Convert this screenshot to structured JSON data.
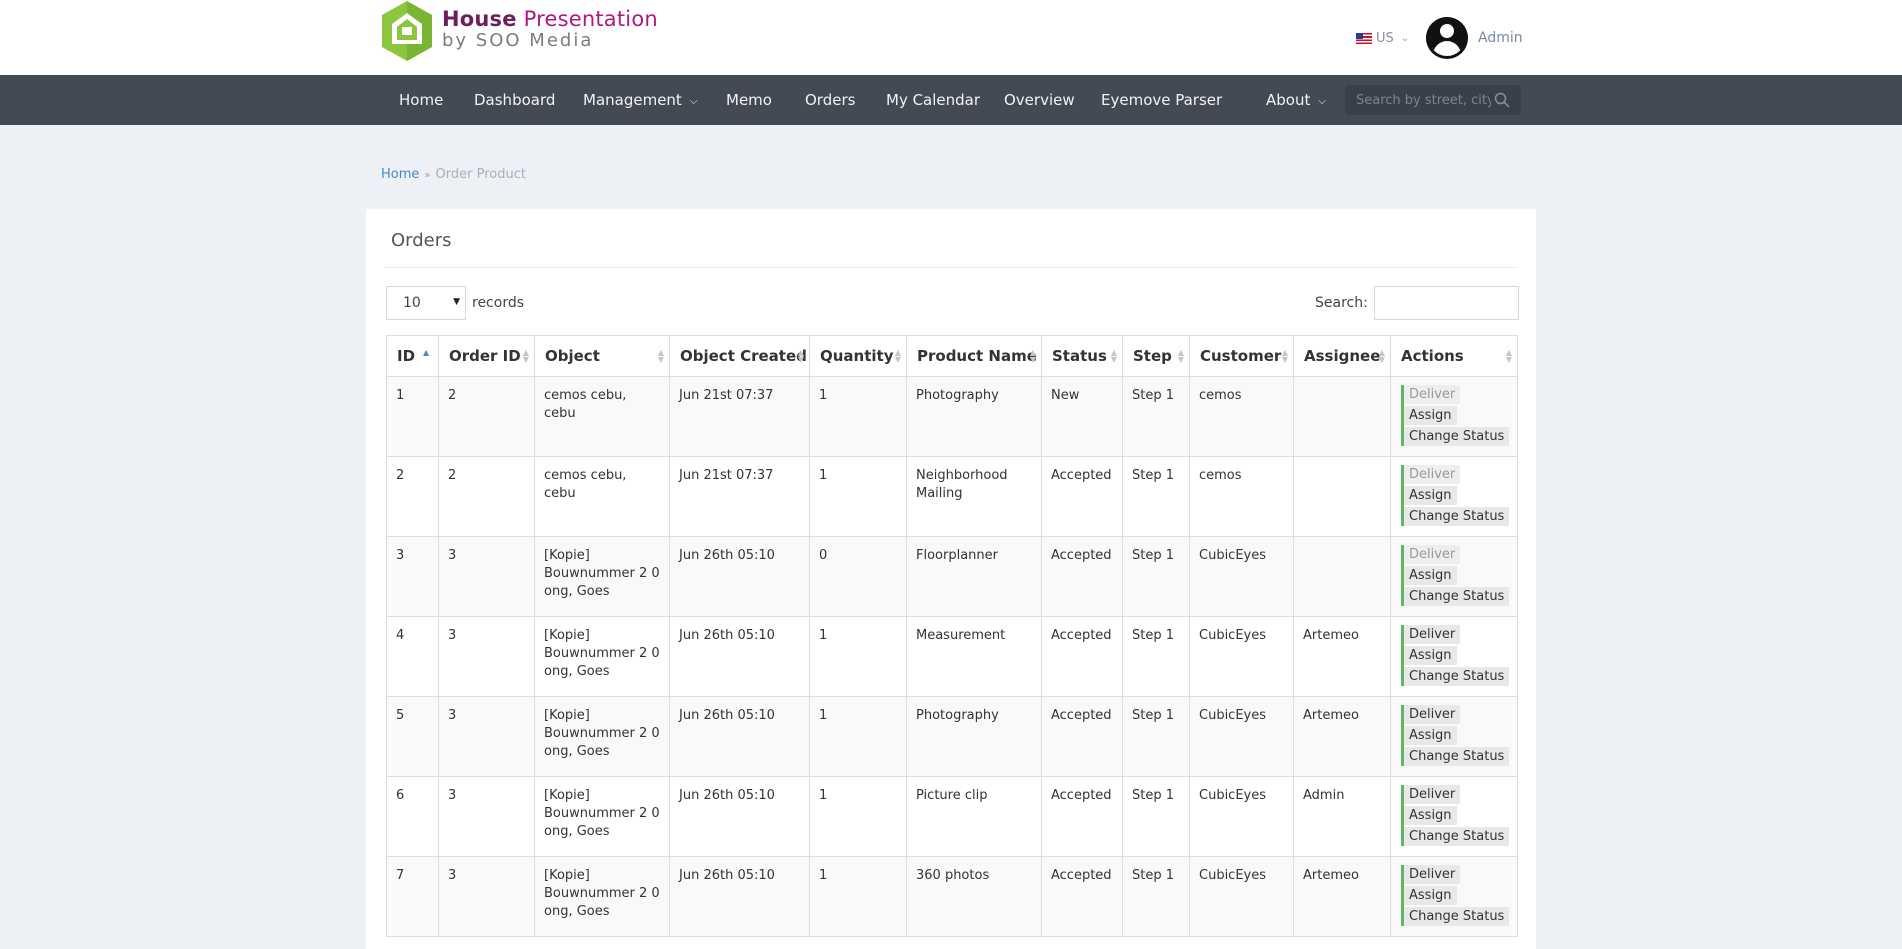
{
  "logo": {
    "house": "House",
    "presentation": "Presentation",
    "tagline": "by SOO Media"
  },
  "header": {
    "language": "US",
    "user": "Admin"
  },
  "nav": {
    "items": [
      {
        "label": "Home"
      },
      {
        "label": "Dashboard"
      },
      {
        "label": "Management",
        "dropdown": true
      },
      {
        "label": "Memo"
      },
      {
        "label": "Orders"
      },
      {
        "label": "My Calendar"
      },
      {
        "label": "Overview"
      },
      {
        "label": "Eyemove Parser"
      },
      {
        "label": "About",
        "dropdown": true
      }
    ],
    "search_placeholder": "Search by street, city or zip"
  },
  "breadcrumb": {
    "home": "Home",
    "current": "Order Product"
  },
  "panel": {
    "title": "Orders",
    "records_value": "10",
    "records_label": "records",
    "search_label": "Search:"
  },
  "table": {
    "columns": [
      "ID",
      "Order ID",
      "Object",
      "Object Created",
      "Quantity",
      "Product Name",
      "Status",
      "Step",
      "Customer",
      "Assignee",
      "Actions"
    ],
    "actions": [
      "Deliver",
      "Assign",
      "Change Status"
    ],
    "rows": [
      {
        "id": "1",
        "order_id": "2",
        "object": "cemos cebu, cebu",
        "created": "Jun 21st 07:37",
        "quantity": "1",
        "product": "Photography",
        "status": "New",
        "step": "Step 1",
        "customer": "cemos",
        "assignee": "",
        "deliver_enabled": false
      },
      {
        "id": "2",
        "order_id": "2",
        "object": "cemos cebu, cebu",
        "created": "Jun 21st 07:37",
        "quantity": "1",
        "product": "Neighborhood Mailing",
        "status": "Accepted",
        "step": "Step 1",
        "customer": "cemos",
        "assignee": "",
        "deliver_enabled": false
      },
      {
        "id": "3",
        "order_id": "3",
        "object": "[Kopie] Bouwnummer 2 0 ong, Goes",
        "created": "Jun 26th 05:10",
        "quantity": "0",
        "product": "Floorplanner",
        "status": "Accepted",
        "step": "Step 1",
        "customer": "CubicEyes",
        "assignee": "",
        "deliver_enabled": false
      },
      {
        "id": "4",
        "order_id": "3",
        "object": "[Kopie] Bouwnummer 2 0 ong, Goes",
        "created": "Jun 26th 05:10",
        "quantity": "1",
        "product": "Measurement",
        "status": "Accepted",
        "step": "Step 1",
        "customer": "CubicEyes",
        "assignee": "Artemeo",
        "deliver_enabled": true
      },
      {
        "id": "5",
        "order_id": "3",
        "object": "[Kopie] Bouwnummer 2 0 ong, Goes",
        "created": "Jun 26th 05:10",
        "quantity": "1",
        "product": "Photography",
        "status": "Accepted",
        "step": "Step 1",
        "customer": "CubicEyes",
        "assignee": "Artemeo",
        "deliver_enabled": true
      },
      {
        "id": "6",
        "order_id": "3",
        "object": "[Kopie] Bouwnummer 2 0 ong, Goes",
        "created": "Jun 26th 05:10",
        "quantity": "1",
        "product": "Picture clip",
        "status": "Accepted",
        "step": "Step 1",
        "customer": "CubicEyes",
        "assignee": "Admin",
        "deliver_enabled": true
      },
      {
        "id": "7",
        "order_id": "3",
        "object": "[Kopie] Bouwnummer 2 0 ong, Goes",
        "created": "Jun 26th 05:10",
        "quantity": "1",
        "product": "360 photos",
        "status": "Accepted",
        "step": "Step 1",
        "customer": "CubicEyes",
        "assignee": "Artemeo",
        "deliver_enabled": true
      }
    ]
  }
}
